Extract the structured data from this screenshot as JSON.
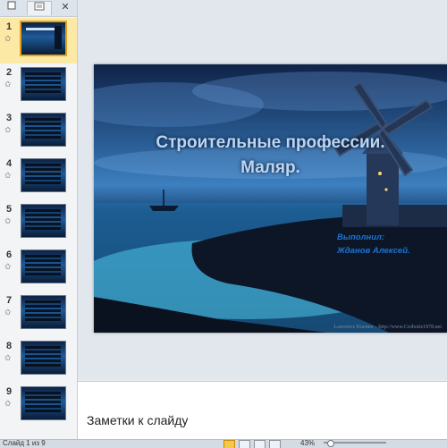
{
  "thumbnail_pane": {
    "tabs": {
      "slides_icon": "slides-tab-icon",
      "outline_icon": "outline-tab-icon",
      "close": "✕"
    },
    "slides": [
      {
        "number": "1",
        "selected": true
      },
      {
        "number": "2"
      },
      {
        "number": "3"
      },
      {
        "number": "4"
      },
      {
        "number": "5"
      },
      {
        "number": "6"
      },
      {
        "number": "7"
      },
      {
        "number": "8"
      },
      {
        "number": "9"
      }
    ],
    "star_icon": "✩"
  },
  "slide": {
    "title_line1": "Строительные  профессии.",
    "title_line2": "Маляр.",
    "author_line1": "Выполнил:",
    "author_line2": "Жданов Алексей.",
    "watermark": "Lawrence Koenen – http://www.Crobotix1978.net"
  },
  "notes": {
    "placeholder": "Заметки к слайду"
  },
  "status_bar": {
    "left_text": "Слайд 1 из 9",
    "zoom": "43%"
  },
  "colors": {
    "selection": "#fce9a6",
    "slide_title": "#bcd6f2",
    "author_text": "#1a73d6"
  }
}
